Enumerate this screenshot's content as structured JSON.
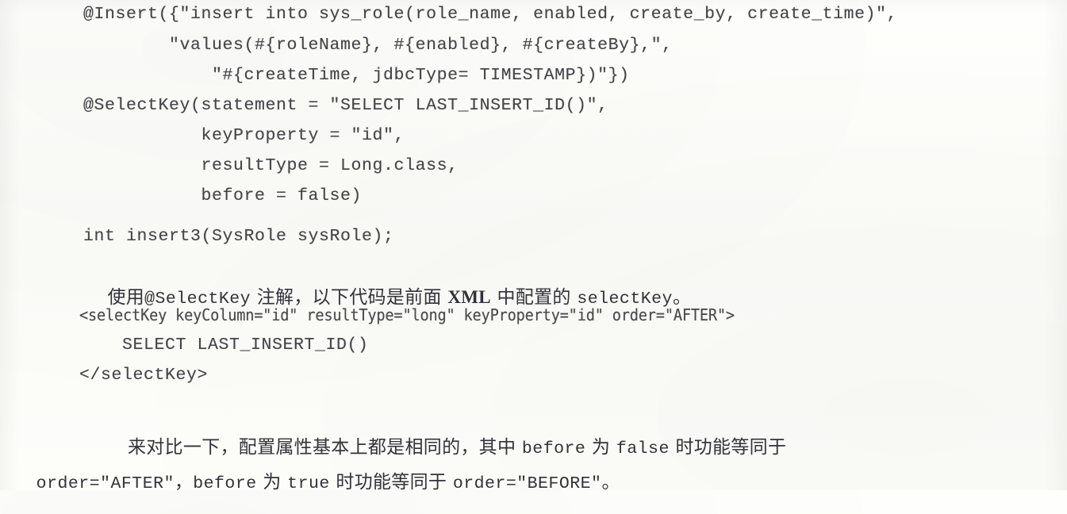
{
  "page": {
    "kind": "scanned-book-page",
    "language": "zh-CN + java/xml code",
    "ink_color": "#45454a",
    "paper_color": "#fdfdfb"
  },
  "code_block_1": {
    "name": "java-annotation-insert3",
    "lines": [
      "@Insert({\"insert into sys_role(role_name, enabled, create_by, create_time)\",",
      "        \"values(#{roleName}, #{enabled}, #{createBy},\",",
      "            \"#{createTime, jdbcType= TIMESTAMP})\"})",
      "@SelectKey(statement = \"SELECT LAST_INSERT_ID()\",",
      "           keyProperty = \"id\",",
      "           resultType = Long.class,",
      "           before = false)",
      "int insert3(SysRole sysRole);"
    ]
  },
  "paragraph_1": {
    "segments": [
      {
        "text": "使用",
        "style": "han"
      },
      {
        "text": "@SelectKey",
        "style": "mono"
      },
      {
        "text": " 注解，以下代码是前面 ",
        "style": "han"
      },
      {
        "text": "XML",
        "style": "serif-bold"
      },
      {
        "text": " 中配置的 ",
        "style": "han"
      },
      {
        "text": "selectKey",
        "style": "mono"
      },
      {
        "text": "。",
        "style": "han"
      }
    ],
    "plain": "使用@SelectKey 注解，以下代码是前面 XML 中配置的 selectKey。"
  },
  "code_block_2": {
    "name": "xml-selectkey-snippet",
    "lines": [
      "<selectKey keyColumn=\"id\" resultType=\"long\" keyProperty=\"id\" order=\"AFTER\">",
      "    SELECT LAST_INSERT_ID()",
      "</selectKey>"
    ]
  },
  "paragraph_2": {
    "line_1_segments": [
      {
        "text": "　来对比一下，配置属性基本上都是相同的，其中 ",
        "style": "han"
      },
      {
        "text": "before",
        "style": "mono"
      },
      {
        "text": " 为 ",
        "style": "han"
      },
      {
        "text": "false",
        "style": "mono"
      },
      {
        "text": " 时功能等同于",
        "style": "han"
      }
    ],
    "line_2_segments": [
      {
        "text": "order=\"AFTER\"",
        "style": "mono"
      },
      {
        "text": "，",
        "style": "han"
      },
      {
        "text": "before",
        "style": "mono"
      },
      {
        "text": " 为 ",
        "style": "han"
      },
      {
        "text": "true",
        "style": "mono"
      },
      {
        "text": " 时功能等同于 ",
        "style": "han"
      },
      {
        "text": "order=\"BEFORE\"",
        "style": "mono"
      },
      {
        "text": "。",
        "style": "han"
      }
    ],
    "plain": "来对比一下，配置属性基本上都是相同的，其中 before 为 false 时功能等同于 order=\"AFTER\"，before 为 true 时功能等同于 order=\"BEFORE\"。"
  }
}
